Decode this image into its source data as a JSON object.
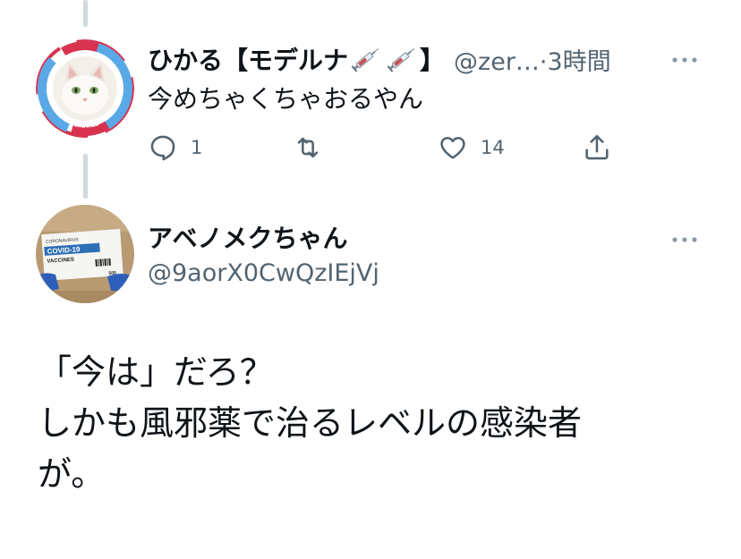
{
  "reply_tweet": {
    "display_name": "ひかる【モデルナ",
    "display_name_suffix": "】",
    "handle": "@zer…",
    "separator": "·",
    "time": "3時間",
    "text": "今めちゃくちゃおるやん",
    "reply_count": "1",
    "retweet_count": "",
    "like_count": "14",
    "avatar_badge_text_top": "I GOT",
    "avatar_badge_text_left": "VACCINATED",
    "avatar_badge_text_bottom": "I GOT VACCINATED"
  },
  "main_tweet": {
    "display_name": "アベノメクちゃん",
    "handle": "@9aorX0CwQzIEjVj",
    "lines": [
      "「今は」だろ？",
      "しかも風邪薬で治るレベルの感染者",
      "が。"
    ],
    "avatar_box": {
      "small_label": "CORONAVIRUS",
      "title": "COVID-19",
      "subtitle": "VACCINES",
      "qty": "500"
    }
  },
  "more_icon": "more-horizontal-icon",
  "colors": {
    "text": "#0f1419",
    "secondary": "#536471",
    "thread_line": "#cfd9de",
    "badge_blue": "#5aa9e6",
    "badge_red": "#d8324f"
  }
}
